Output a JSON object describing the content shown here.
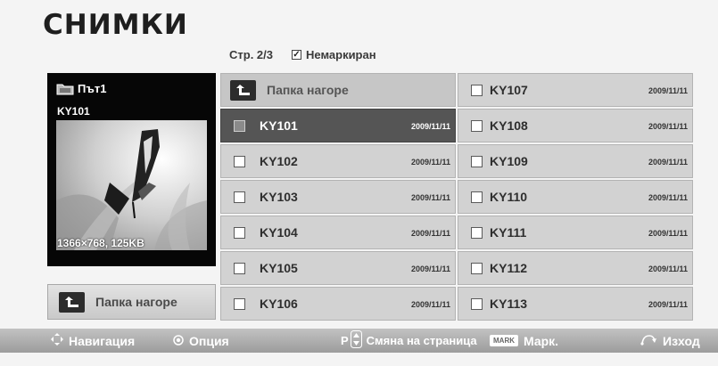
{
  "header": {
    "title": "СНИМКИ"
  },
  "pager": {
    "page": "Стр. 2/3",
    "unmarked_label": "Немаркиран"
  },
  "preview": {
    "path_label": "Път1",
    "file_name": "KY101",
    "info": "1366×768, 125KB",
    "path_icon": "folder-icon",
    "image_subject": "butterfly"
  },
  "up_button": {
    "label": "Папка нагоре",
    "icon": "folder-up-icon"
  },
  "grid": {
    "up_label": "Папка нагоре",
    "left_items": [
      {
        "name": "KY101",
        "date": "2009/11/11",
        "selected": true
      },
      {
        "name": "KY102",
        "date": "2009/11/11"
      },
      {
        "name": "KY103",
        "date": "2009/11/11"
      },
      {
        "name": "KY104",
        "date": "2009/11/11"
      },
      {
        "name": "KY105",
        "date": "2009/11/11"
      },
      {
        "name": "KY106",
        "date": "2009/11/11"
      }
    ],
    "right_items": [
      {
        "name": "KY107",
        "date": "2009/11/11"
      },
      {
        "name": "KY108",
        "date": "2009/11/11"
      },
      {
        "name": "KY109",
        "date": "2009/11/11"
      },
      {
        "name": "KY110",
        "date": "2009/11/11"
      },
      {
        "name": "KY111",
        "date": "2009/11/11"
      },
      {
        "name": "KY112",
        "date": "2009/11/11"
      },
      {
        "name": "KY113",
        "date": "2009/11/11"
      }
    ]
  },
  "footer": {
    "navigation": "Навигация",
    "option": "Опция",
    "page_key": "P",
    "page_change": "Смяна на страница",
    "mark_badge": "MARK",
    "mark": "Марк.",
    "exit": "Изход"
  },
  "colors": {
    "selected_bg": "#555555",
    "cell_bg": "#d2d2d2",
    "footer_bg": "#a9a9a9"
  }
}
